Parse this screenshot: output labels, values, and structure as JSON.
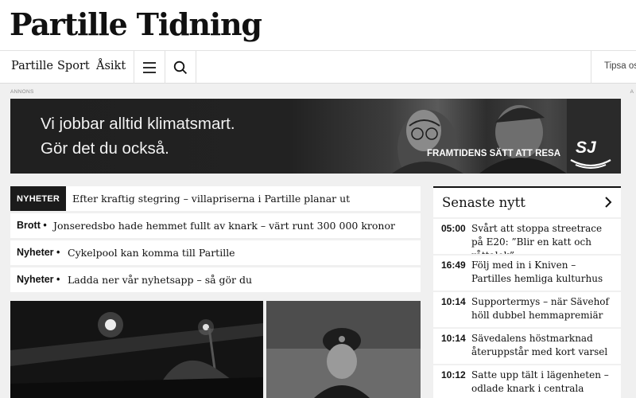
{
  "site": {
    "name": "Partille Tidning"
  },
  "nav": {
    "links": [
      "Partille",
      "Sport",
      "Åsikt"
    ],
    "menu_icon": "hamburger-menu-icon",
    "search_icon": "search-icon",
    "tip_label": "Tipsa os"
  },
  "ad": {
    "label": "ANNONS",
    "corner_mark": "A",
    "line1": "Vi jobbar alltid klimatsmart.",
    "line2": "Gör det du också.",
    "tagline": "FRAMTIDENS SÄTT ATT RESA",
    "brand": "SJ"
  },
  "headlines": [
    {
      "category": "NYHETER",
      "title": "Efter kraftig stegring – villapriserna i Partille planar ut"
    },
    {
      "category": "Brott",
      "title": "Jonseredsbo hade hemmet fullt av knark – värt runt 300 000 kronor"
    },
    {
      "category": "Nyheter",
      "title": "Cykelpool kan komma till Partille"
    },
    {
      "category": "Nyheter",
      "title": "Ladda ner vår nyhetsapp – så gör du"
    }
  ],
  "latest": {
    "title": "Senaste nytt",
    "chevron_icon": "chevron-right-icon",
    "items": [
      {
        "time": "05:00",
        "text": "Svårt att stoppa streetrace på E20: ”Blir en katt och råttalek”"
      },
      {
        "time": "16:49",
        "text": "Följ med in i Kniven – Partilles hemliga kulturhus"
      },
      {
        "time": "10:14",
        "text": "Supportermys – när Sävehof höll dubbel hemmapremiär"
      },
      {
        "time": "10:14",
        "text": "Sävedalens höstmarknad återuppstår med kort varsel"
      },
      {
        "time": "10:12",
        "text": "Satte upp tält i lägenheten – odlade knark i centrala Partille"
      }
    ]
  },
  "colors": {
    "header_bg": "#ffffff",
    "page_bg": "#f0f0f0",
    "ink": "#111111",
    "badge_bg": "#1b1b1b"
  }
}
